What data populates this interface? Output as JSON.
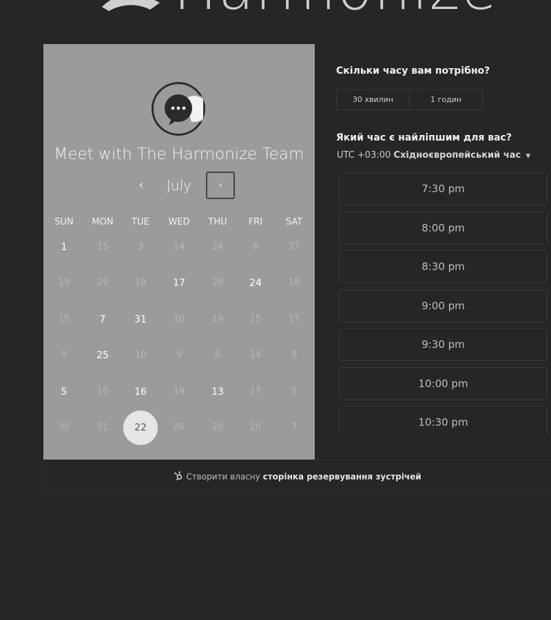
{
  "brand": {
    "name": "Harmonize"
  },
  "panel": {
    "title": "Meet with The Harmonize Team",
    "month": "July",
    "prev": "‹",
    "next": "›",
    "weekdays": [
      "SUN",
      "MON",
      "TUE",
      "WED",
      "THU",
      "FRI",
      "SAT"
    ],
    "weeks": [
      [
        {
          "d": "1",
          "s": "avail"
        },
        {
          "d": "15",
          "s": "dim"
        },
        {
          "d": "3",
          "s": "dim"
        },
        {
          "d": "14",
          "s": "dim"
        },
        {
          "d": "24",
          "s": "dim"
        },
        {
          "d": "6",
          "s": "dim"
        },
        {
          "d": "27",
          "s": "dim"
        }
      ],
      [
        {
          "d": "19",
          "s": "dim"
        },
        {
          "d": "29",
          "s": "dim"
        },
        {
          "d": "19",
          "s": "dim"
        },
        {
          "d": "17",
          "s": "avail"
        },
        {
          "d": "29",
          "s": "dim"
        },
        {
          "d": "24",
          "s": "avail"
        },
        {
          "d": "18",
          "s": "dim"
        }
      ],
      [
        {
          "d": "15",
          "s": "dim"
        },
        {
          "d": "7",
          "s": "avail"
        },
        {
          "d": "31",
          "s": "avail"
        },
        {
          "d": "10",
          "s": "dim"
        },
        {
          "d": "19",
          "s": "dim"
        },
        {
          "d": "15",
          "s": "dim"
        },
        {
          "d": "17",
          "s": "dim"
        }
      ],
      [
        {
          "d": "9",
          "s": "dim"
        },
        {
          "d": "25",
          "s": "avail"
        },
        {
          "d": "10",
          "s": "dim"
        },
        {
          "d": "9",
          "s": "dim"
        },
        {
          "d": "6",
          "s": "dim"
        },
        {
          "d": "14",
          "s": "dim"
        },
        {
          "d": "8",
          "s": "dim"
        }
      ],
      [
        {
          "d": "5",
          "s": "avail"
        },
        {
          "d": "10",
          "s": "dim"
        },
        {
          "d": "16",
          "s": "avail"
        },
        {
          "d": "19",
          "s": "dim"
        },
        {
          "d": "13",
          "s": "avail"
        },
        {
          "d": "17",
          "s": "dim"
        },
        {
          "d": "5",
          "s": "dim"
        }
      ],
      [
        {
          "d": "30",
          "s": "dim"
        },
        {
          "d": "31",
          "s": "dim"
        },
        {
          "d": "22",
          "s": "selected"
        },
        {
          "d": "26",
          "s": "dim"
        },
        {
          "d": "20",
          "s": "dim"
        },
        {
          "d": "20",
          "s": "dim"
        },
        {
          "d": "7",
          "s": "dim"
        }
      ]
    ]
  },
  "duration": {
    "title": "Скільки часу вам потрібно?",
    "options": [
      "30 хвилин",
      "1 годин"
    ]
  },
  "time": {
    "title": "Який час є найліпшим для вас?",
    "timezone_offset": "UTC +03:00",
    "timezone_name": "Східноєвропейський час",
    "caret": "▼",
    "slots": [
      "7:30 pm",
      "8:00 pm",
      "8:30 pm",
      "9:00 pm",
      "9:30 pm",
      "10:00 pm",
      "10:30 pm"
    ]
  },
  "footer": {
    "prefix": "Створити власну",
    "bold": "сторінка резервування зустрічей"
  }
}
